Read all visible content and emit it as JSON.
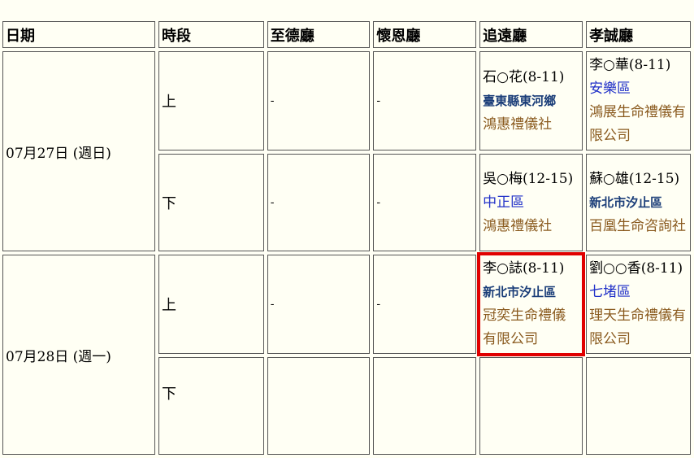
{
  "headers": [
    "日期",
    "時段",
    "至德廳",
    "懷恩廳",
    "追遠廳",
    "孝誠廳"
  ],
  "dates": [
    {
      "label": "07月27日 (週日)"
    },
    {
      "label": "07月28日 (週一)"
    }
  ],
  "rows": [
    {
      "period": "上",
      "zhide": "-",
      "huaien": "-",
      "zhuiyuan": {
        "name": "石○花(8-11)",
        "region": "臺東縣東河鄉",
        "region_style": "bold",
        "company": "鴻惠禮儀社"
      },
      "xiaocheng": {
        "name": "李○華(8-11)",
        "region": "安樂區",
        "region_style": "normal",
        "company": "鴻展生命禮儀有限公司"
      }
    },
    {
      "period": "下",
      "zhide": "-",
      "huaien": "-",
      "zhuiyuan": {
        "name": "吳○梅(12-15)",
        "region": "中正區",
        "region_style": "normal",
        "company": "鴻惠禮儀社"
      },
      "xiaocheng": {
        "name": "蘇○雄(12-15)",
        "region": "新北市汐止區",
        "region_style": "bold",
        "company": "百凰生命咨詢社"
      }
    },
    {
      "period": "上",
      "zhide": "-",
      "huaien": "-",
      "zhuiyuan": {
        "name": "李○誌(8-11)",
        "region": "新北市汐止區",
        "region_style": "bold",
        "company": "冠奕生命禮儀有限公司"
      },
      "xiaocheng": {
        "name": "劉○○香(8-11)",
        "region": "七堵區",
        "region_style": "normal",
        "company": "理天生命禮儀有限公司"
      }
    },
    {
      "period": "下"
    }
  ],
  "highlight_color": "#e00000"
}
